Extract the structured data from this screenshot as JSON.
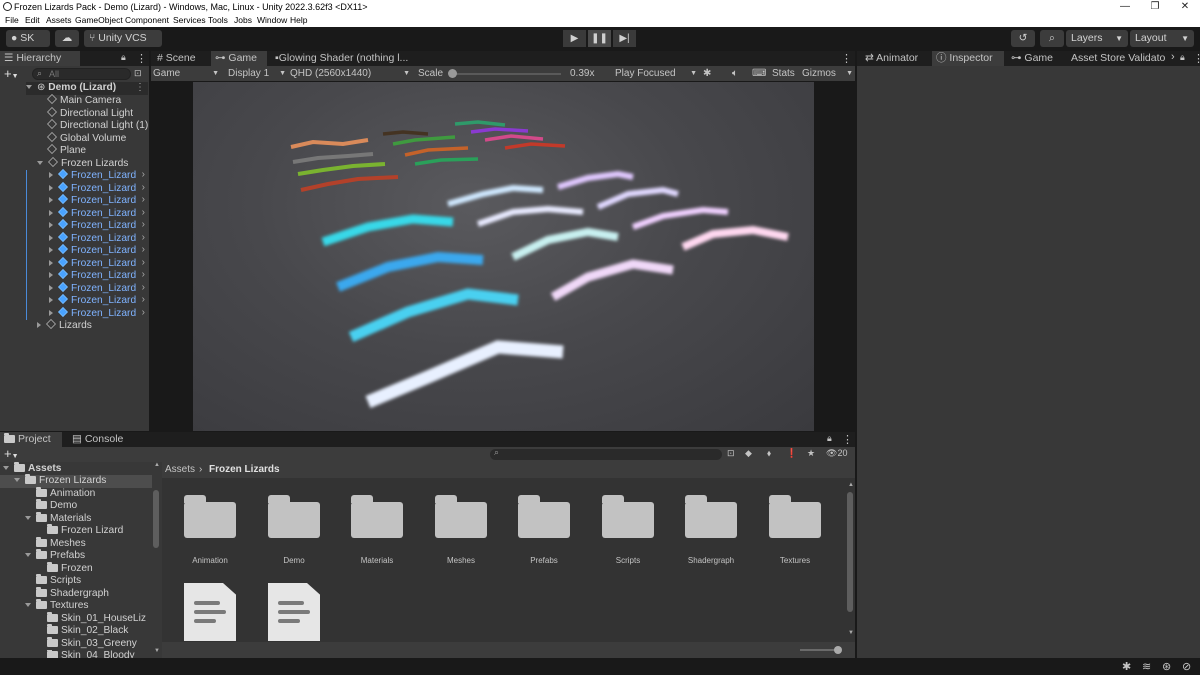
{
  "window": {
    "title": "Frozen Lizards Pack - Demo (Lizard) - Windows, Mac, Linux - Unity 2022.3.62f3 <DX11>"
  },
  "menu": [
    "File",
    "Edit",
    "Assets",
    "GameObject",
    "Component",
    "Services",
    "Tools",
    "Jobs",
    "Window",
    "Help"
  ],
  "toolbar": {
    "account": "SK",
    "vcs": "Unity VCS",
    "layers": "Layers",
    "layout": "Layout"
  },
  "hierarchy": {
    "tab": "Hierarchy",
    "search_placeholder": "All",
    "scene": "Demo (Lizard)",
    "items": [
      "Main Camera",
      "Directional Light",
      "Directional Light (1)",
      "Global Volume",
      "Plane",
      "Frozen Lizards"
    ],
    "lizards": [
      "Frozen_Lizard",
      "Frozen_Lizard",
      "Frozen_Lizard",
      "Frozen_Lizard",
      "Frozen_Lizard",
      "Frozen_Lizard",
      "Frozen_Lizard",
      "Frozen_Lizard",
      "Frozen_Lizard",
      "Frozen_Lizard",
      "Frozen_Lizard",
      "Frozen_Lizard"
    ],
    "last": "Lizards"
  },
  "center_tabs": {
    "scene": "Scene",
    "game": "Game",
    "shader": "Glowing Shader (nothing l..."
  },
  "game_bar": {
    "mode": "Game",
    "display": "Display 1",
    "resolution": "QHD (2560x1440)",
    "scale_label": "Scale",
    "scale_value": "0.39x",
    "play_focused": "Play Focused",
    "stats": "Stats",
    "gizmos": "Gizmos"
  },
  "right_tabs": {
    "animator": "Animator",
    "inspector": "Inspector",
    "game": "Game",
    "asset_store": "Asset Store Validato"
  },
  "bottom_tabs": {
    "project": "Project",
    "console": "Console"
  },
  "project_tree": {
    "assets": "Assets",
    "items": [
      {
        "label": "Frozen Lizards",
        "level": 1,
        "open": true
      },
      {
        "label": "Animation",
        "level": 2
      },
      {
        "label": "Demo",
        "level": 2
      },
      {
        "label": "Materials",
        "level": 2,
        "open": true
      },
      {
        "label": "Frozen Lizard",
        "level": 3
      },
      {
        "label": "Meshes",
        "level": 2
      },
      {
        "label": "Prefabs",
        "level": 2,
        "open": true
      },
      {
        "label": "Frozen",
        "level": 3
      },
      {
        "label": "Scripts",
        "level": 2
      },
      {
        "label": "Shadergraph",
        "level": 2
      },
      {
        "label": "Textures",
        "level": 2,
        "open": true
      },
      {
        "label": "Skin_01_HouseLiz",
        "level": 3
      },
      {
        "label": "Skin_02_Black",
        "level": 3
      },
      {
        "label": "Skin_03_Greeny",
        "level": 3
      },
      {
        "label": "Skin_04_Bloody",
        "level": 3
      }
    ]
  },
  "breadcrumb": {
    "root": "Assets",
    "current": "Frozen Lizards"
  },
  "hidden_count": "20",
  "folders": [
    "Animation",
    "Demo",
    "Materials",
    "Meshes",
    "Prefabs",
    "Scripts",
    "Shadergraph",
    "Textures"
  ]
}
